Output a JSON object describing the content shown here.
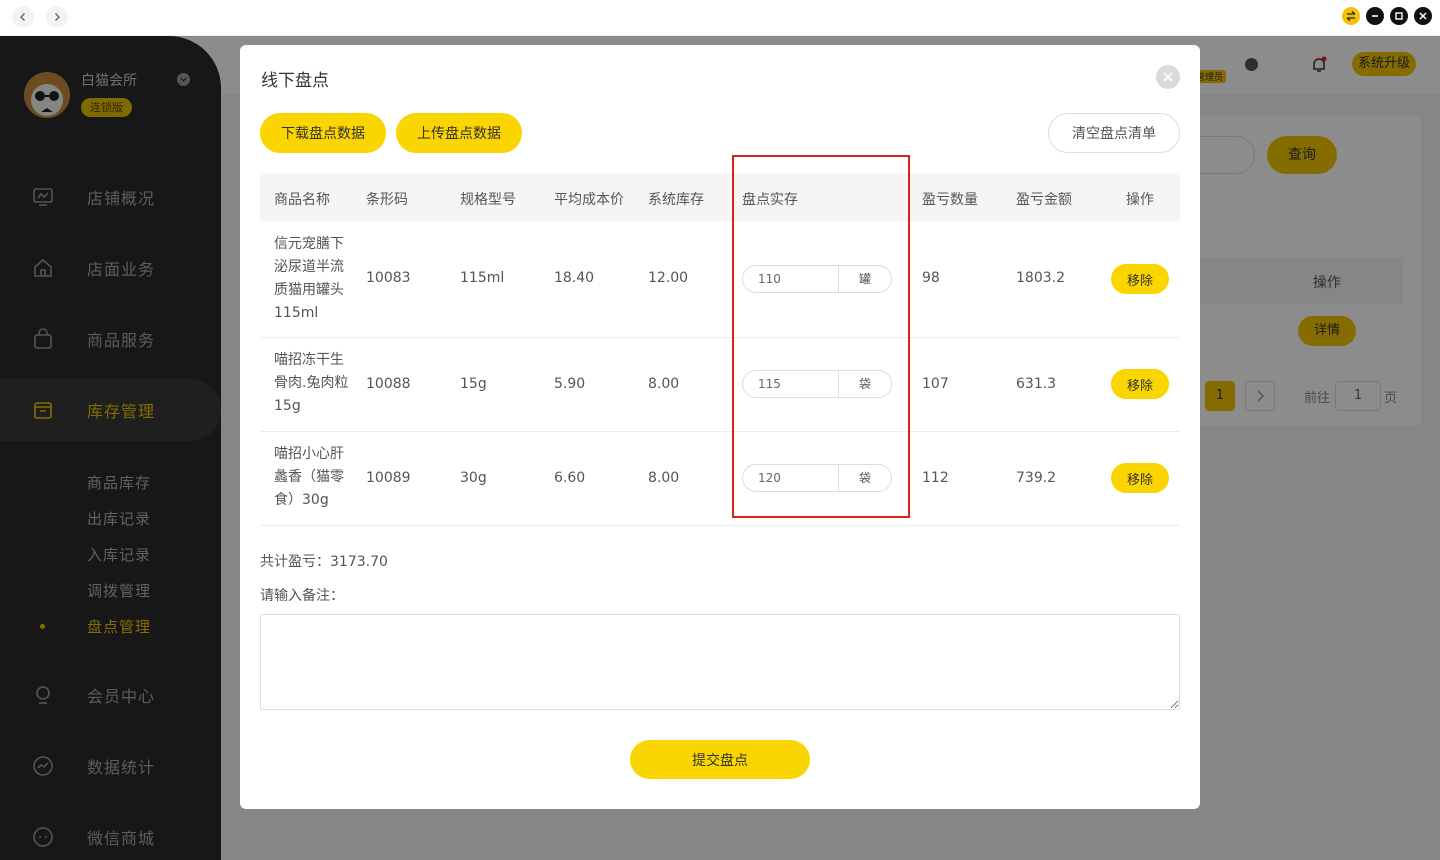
{
  "sidebar": {
    "shop_name": "白猫会所",
    "shop_badge": "连锁版",
    "nav": [
      {
        "label": "店铺概况",
        "icon": "monitor-icon"
      },
      {
        "label": "店面业务",
        "icon": "home-icon"
      },
      {
        "label": "商品服务",
        "icon": "bag-icon"
      },
      {
        "label": "库存管理",
        "icon": "box-icon"
      },
      {
        "label": "会员中心",
        "icon": "member-icon"
      },
      {
        "label": "数据统计",
        "icon": "chart-icon"
      },
      {
        "label": "微信商城",
        "icon": "chat-icon"
      }
    ],
    "sub": [
      "商品库存",
      "出库记录",
      "入库记录",
      "调拨管理",
      "盘点管理"
    ]
  },
  "background": {
    "admin_badge": "管理员",
    "upgrade": "系统升级",
    "query": "查询",
    "ops_header": "操作",
    "detail": "详情",
    "page_num": "1",
    "goto": "前往",
    "goto_value": "1",
    "page_suffix": "页"
  },
  "modal": {
    "title": "线下盘点",
    "download": "下载盘点数据",
    "upload": "上传盘点数据",
    "clear": "清空盘点清单",
    "headers": [
      "商品名称",
      "条形码",
      "规格型号",
      "平均成本价",
      "系统库存",
      "盘点实存",
      "盈亏数量",
      "盈亏金额",
      "操作"
    ],
    "rows": [
      {
        "name": "信元宠膳下泌尿道半流质猫用罐头115ml",
        "barcode": "10083",
        "spec": "115ml",
        "cost": "18.40",
        "stock": "12.00",
        "actual": "110",
        "unit": "罐",
        "diff": "98",
        "amount": "1803.2",
        "op": "移除"
      },
      {
        "name": "喵招冻干生骨肉.兔肉粒15g",
        "barcode": "10088",
        "spec": "15g",
        "cost": "5.90",
        "stock": "8.00",
        "actual": "115",
        "unit": "袋",
        "diff": "107",
        "amount": "631.3",
        "op": "移除"
      },
      {
        "name": "喵招小心肝蠡香（猫零食）30g",
        "barcode": "10089",
        "spec": "30g",
        "cost": "6.60",
        "stock": "8.00",
        "actual": "120",
        "unit": "袋",
        "diff": "112",
        "amount": "739.2",
        "op": "移除"
      }
    ],
    "total": "共计盈亏：3173.70",
    "remark_label": "请输入备注：",
    "submit": "提交盘点"
  },
  "colors": {
    "accent": "#fad500",
    "sidebar": "#2b2b2b",
    "highlight": "#e02020"
  }
}
